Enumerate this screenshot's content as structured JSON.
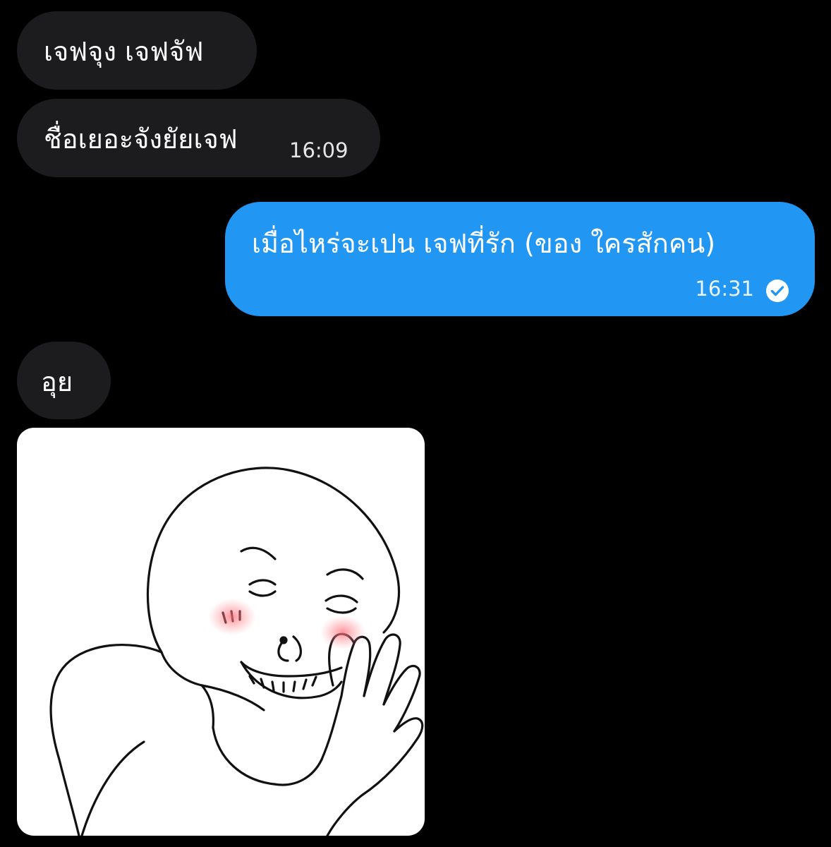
{
  "messages": [
    {
      "direction": "incoming",
      "text": "เจฟจุง เจฟจัฟ"
    },
    {
      "direction": "incoming",
      "text": "ชื่อเยอะจังยัยเจฟ",
      "time": "16:09"
    },
    {
      "direction": "outgoing",
      "text": "เมื่อไหร่จะเปน เจฟที่รัก (ของ ใครสักคน)",
      "time": "16:31",
      "status": "read"
    },
    {
      "direction": "incoming",
      "text": "อุย"
    }
  ],
  "colors": {
    "background": "#000000",
    "incoming_bubble": "#1c1c1e",
    "outgoing_bubble": "#2196f3"
  },
  "icons": {
    "read_status": "check-circle-icon"
  }
}
